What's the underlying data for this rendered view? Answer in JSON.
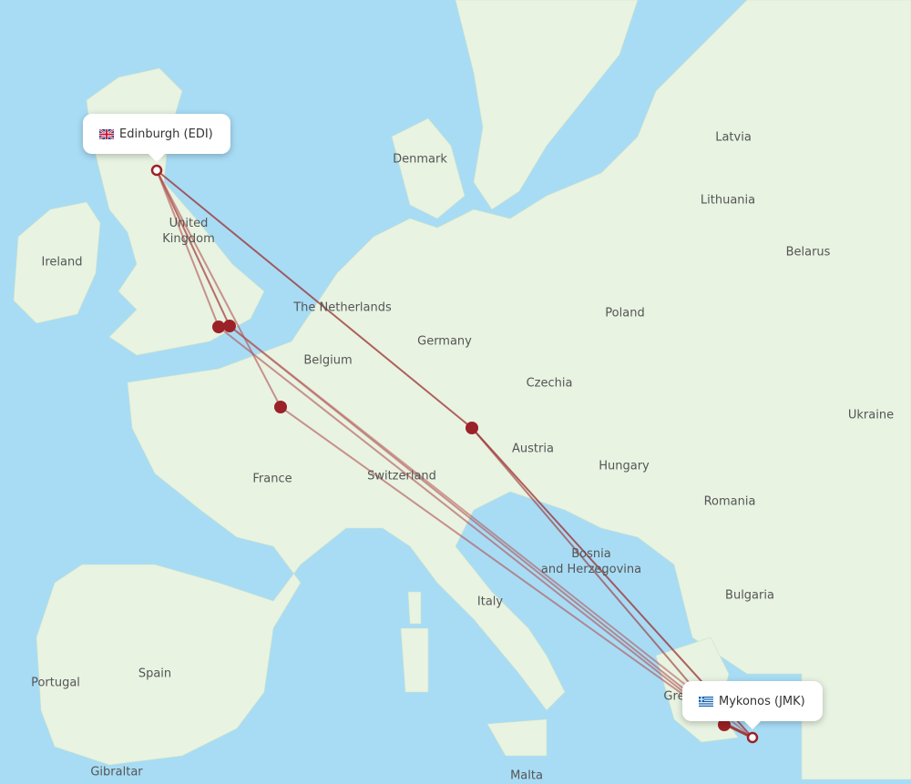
{
  "origin": {
    "name": "Edinburgh (EDI)",
    "flag": "uk-flag-icon"
  },
  "destination": {
    "name": "Mykonos (JMK)",
    "flag": "greece-flag-icon"
  },
  "colors": {
    "route": "#9b2f2f",
    "route_light": "#c98a8a",
    "water": "#a8dcf5",
    "land": "#e8f3e2",
    "stop": "#9b2226"
  },
  "labels": [
    {
      "id": "denmark",
      "text": "Denmark"
    },
    {
      "id": "latvia",
      "text": "Latvia"
    },
    {
      "id": "lithuania",
      "text": "Lithuania"
    },
    {
      "id": "belarus",
      "text": "Belarus"
    },
    {
      "id": "ireland",
      "text": "Ireland"
    },
    {
      "id": "uk",
      "text": "United\nKingdom"
    },
    {
      "id": "netherlands",
      "text": "The Netherlands"
    },
    {
      "id": "germany",
      "text": "Germany"
    },
    {
      "id": "poland",
      "text": "Poland"
    },
    {
      "id": "belgium",
      "text": "Belgium"
    },
    {
      "id": "czechia",
      "text": "Czechia"
    },
    {
      "id": "ukraine",
      "text": "Ukraine"
    },
    {
      "id": "austria",
      "text": "Austria"
    },
    {
      "id": "france",
      "text": "France"
    },
    {
      "id": "switzerland",
      "text": "Switzerland"
    },
    {
      "id": "hungary",
      "text": "Hungary"
    },
    {
      "id": "romania",
      "text": "Romania"
    },
    {
      "id": "bosnia",
      "text": "Bosnia\nand Herzegovina"
    },
    {
      "id": "italy",
      "text": "Italy"
    },
    {
      "id": "bulgaria",
      "text": "Bulgaria"
    },
    {
      "id": "portugal",
      "text": "Portugal"
    },
    {
      "id": "spain",
      "text": "Spain"
    },
    {
      "id": "greece",
      "text": "Gre"
    },
    {
      "id": "gibraltar",
      "text": "Gibraltar"
    },
    {
      "id": "malta",
      "text": "Malta"
    }
  ]
}
